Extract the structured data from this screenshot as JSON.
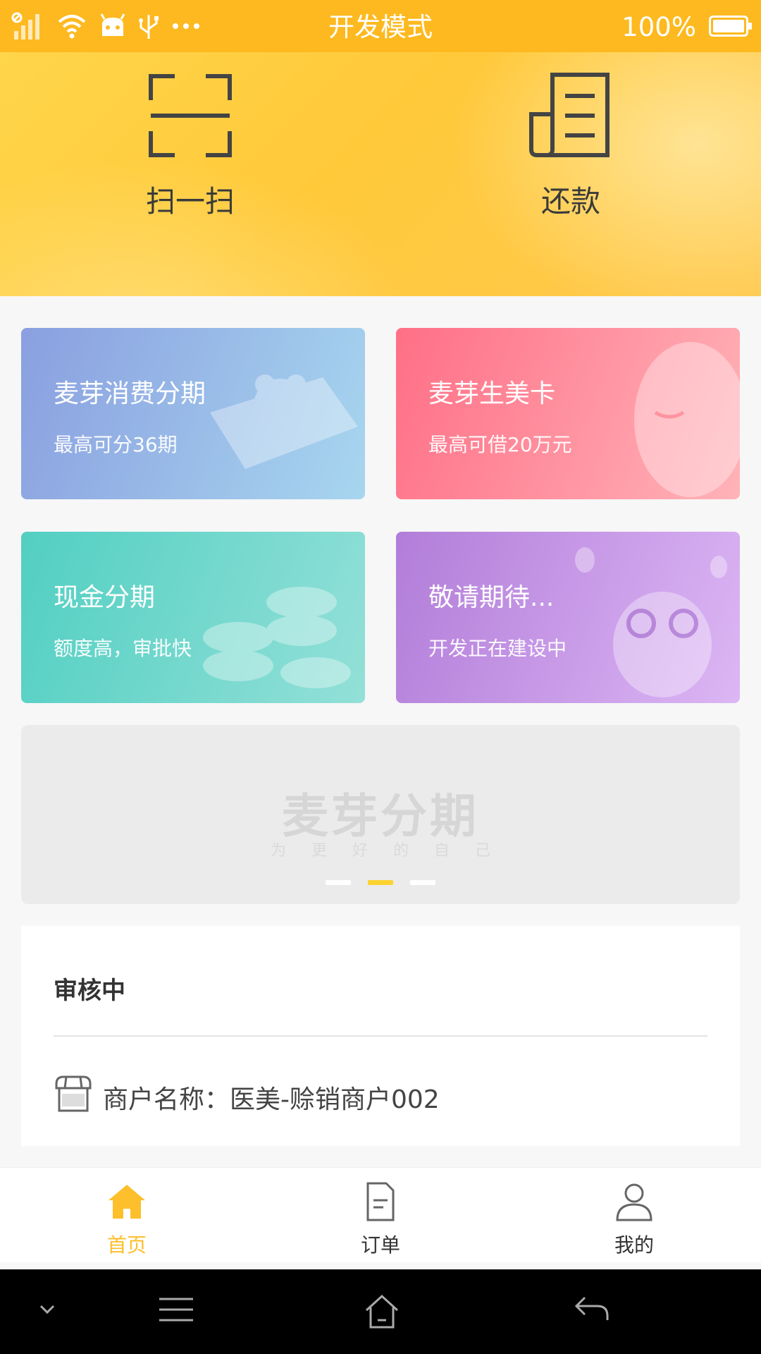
{
  "status_bar": {
    "title": "开发模式",
    "battery_text": "100%",
    "battery_level": 1.0,
    "icons": [
      "signal-icon",
      "wifi-icon",
      "android-icon",
      "usb-icon",
      "more-icon"
    ]
  },
  "header": {
    "actions": [
      {
        "label": "扫一扫",
        "icon": "scan-icon"
      },
      {
        "label": "还款",
        "icon": "repay-icon"
      }
    ]
  },
  "cards": [
    {
      "title": "麦芽消费分期",
      "subtitle": "最高可分36期",
      "colors": [
        "#8a9fe0",
        "#a7d6ef"
      ]
    },
    {
      "title": "麦芽生美卡",
      "subtitle": "最高可借20万元",
      "colors": [
        "#ff6f86",
        "#ffb3b8"
      ]
    },
    {
      "title": "现金分期",
      "subtitle": "额度高，审批快",
      "colors": [
        "#52cfc2",
        "#93e0d8"
      ]
    },
    {
      "title": "敬请期待...",
      "subtitle": "开发正在建设中",
      "colors": [
        "#b27dd9",
        "#dcb6f4"
      ]
    }
  ],
  "banner": {
    "logo_text": "麦芽分期",
    "slogan": "为更好的自己",
    "page_count": 3,
    "active_index": 1
  },
  "review": {
    "title": "审核中",
    "merchant_label": "商户名称：医美-赊销商户002",
    "merchant_icon": "store-icon"
  },
  "tabs": [
    {
      "label": "首页",
      "icon": "home-icon",
      "active": true
    },
    {
      "label": "订单",
      "icon": "order-icon",
      "active": false
    },
    {
      "label": "我的",
      "icon": "user-icon",
      "active": false
    }
  ],
  "colors": {
    "accent": "#fdb91f",
    "tab_active": "#fdbf2b",
    "tab_inactive": "#333333"
  }
}
